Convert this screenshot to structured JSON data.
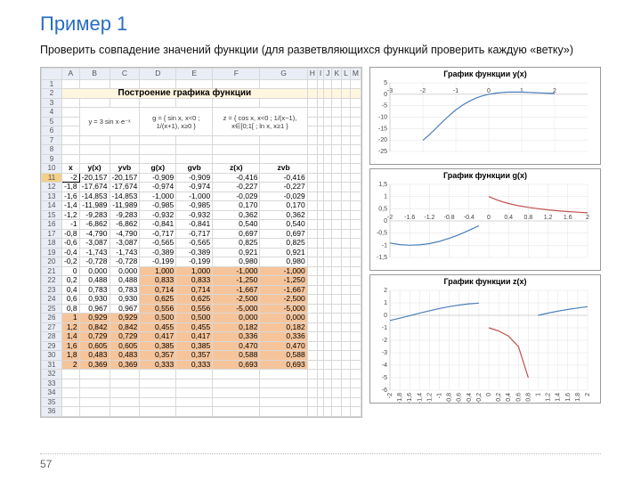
{
  "title": "Пример 1",
  "subtitle": "Проверить совпадение значений функции (для разветвляющихся функций проверить каждую «ветку»)",
  "pagenum": "57",
  "columns": [
    "",
    "A",
    "B",
    "C",
    "D",
    "E",
    "F",
    "G",
    "H",
    "I",
    "J",
    "K",
    "L",
    "M"
  ],
  "sheet_title": "Построение графика функции",
  "formula_y": "y = 3 sin x·e⁻ˣ",
  "formula_g": "g = { sin x, x<0 ; 1/(x+1), x≥0 }",
  "formula_z": "z = { cos x, x<0 ; 1/(x−1), x∈[0;1[ ; ln x, x≥1 }",
  "headers": [
    "x",
    "y(x)",
    "yvb",
    "g(x)",
    "gvb",
    "z(x)",
    "zvb"
  ],
  "rows": [
    {
      "n": 11,
      "sel": true,
      "x": "-2",
      "y": "-20,157",
      "yvb": "-20,157",
      "g": "-0,909",
      "gvb": "-0,909",
      "z": "-0,416",
      "zvb": "-0,416"
    },
    {
      "n": 12,
      "x": "-1,8",
      "y": "-17,674",
      "yvb": "-17,674",
      "g": "-0,974",
      "gvb": "-0,974",
      "z": "-0,227",
      "zvb": "-0,227"
    },
    {
      "n": 13,
      "x": "-1,6",
      "y": "-14,853",
      "yvb": "-14,853",
      "g": "-1,000",
      "gvb": "-1,000",
      "z": "-0,029",
      "zvb": "-0,029"
    },
    {
      "n": 14,
      "x": "-1,4",
      "y": "-11,989",
      "yvb": "-11,989",
      "g": "-0,985",
      "gvb": "-0,985",
      "z": "0,170",
      "zvb": "0,170"
    },
    {
      "n": 15,
      "x": "-1,2",
      "y": "-9,283",
      "yvb": "-9,283",
      "g": "-0,932",
      "gvb": "-0,932",
      "z": "0,362",
      "zvb": "0,362"
    },
    {
      "n": 16,
      "x": "-1",
      "y": "-6,862",
      "yvb": "-6,862",
      "g": "-0,841",
      "gvb": "-0,841",
      "z": "0,540",
      "zvb": "0,540"
    },
    {
      "n": 17,
      "x": "-0,8",
      "y": "-4,790",
      "yvb": "-4,790",
      "g": "-0,717",
      "gvb": "-0,717",
      "z": "0,697",
      "zvb": "0,697"
    },
    {
      "n": 18,
      "x": "-0,6",
      "y": "-3,087",
      "yvb": "-3,087",
      "g": "-0,565",
      "gvb": "-0,565",
      "z": "0,825",
      "zvb": "0,825"
    },
    {
      "n": 19,
      "x": "-0,4",
      "y": "-1,743",
      "yvb": "-1,743",
      "g": "-0,389",
      "gvb": "-0,389",
      "z": "0,921",
      "zvb": "0,921"
    },
    {
      "n": 20,
      "x": "-0,2",
      "y": "-0,728",
      "yvb": "-0,728",
      "g": "-0,199",
      "gvb": "-0,199",
      "z": "0,980",
      "zvb": "0,980"
    },
    {
      "n": 21,
      "peach": "gz",
      "x": "0",
      "y": "0,000",
      "yvb": "0,000",
      "g": "1,000",
      "gvb": "1,000",
      "z": "-1,000",
      "zvb": "-1,000"
    },
    {
      "n": 22,
      "peach": "gz",
      "x": "0,2",
      "y": "0,488",
      "yvb": "0,488",
      "g": "0,833",
      "gvb": "0,833",
      "z": "-1,250",
      "zvb": "-1,250"
    },
    {
      "n": 23,
      "peach": "gz",
      "x": "0,4",
      "y": "0,783",
      "yvb": "0,783",
      "g": "0,714",
      "gvb": "0,714",
      "z": "-1,667",
      "zvb": "-1,667"
    },
    {
      "n": 24,
      "peach": "gz",
      "x": "0,6",
      "y": "0,930",
      "yvb": "0,930",
      "g": "0,625",
      "gvb": "0,625",
      "z": "-2,500",
      "zvb": "-2,500"
    },
    {
      "n": 25,
      "peach": "gz",
      "x": "0,8",
      "y": "0,967",
      "yvb": "0,967",
      "g": "0,556",
      "gvb": "0,556",
      "z": "-5,000",
      "zvb": "-5,000"
    },
    {
      "n": 26,
      "peach": "all",
      "x": "1",
      "y": "0,929",
      "yvb": "0,929",
      "g": "0,500",
      "gvb": "0,500",
      "z": "0,000",
      "zvb": "0,000"
    },
    {
      "n": 27,
      "peach": "all",
      "x": "1,2",
      "y": "0,842",
      "yvb": "0,842",
      "g": "0,455",
      "gvb": "0,455",
      "z": "0,182",
      "zvb": "0,182"
    },
    {
      "n": 28,
      "peach": "all",
      "x": "1,4",
      "y": "0,729",
      "yvb": "0,729",
      "g": "0,417",
      "gvb": "0,417",
      "z": "0,336",
      "zvb": "0,336"
    },
    {
      "n": 29,
      "peach": "all",
      "x": "1,6",
      "y": "0,605",
      "yvb": "0,605",
      "g": "0,385",
      "gvb": "0,385",
      "z": "0,470",
      "zvb": "0,470"
    },
    {
      "n": 30,
      "peach": "all",
      "x": "1,8",
      "y": "0,483",
      "yvb": "0,483",
      "g": "0,357",
      "gvb": "0,357",
      "z": "0,588",
      "zvb": "0,588"
    },
    {
      "n": 31,
      "peach": "all",
      "x": "2",
      "y": "0,369",
      "yvb": "0,369",
      "g": "0,333",
      "gvb": "0,333",
      "z": "0,693",
      "zvb": "0,693"
    }
  ],
  "empty_rows": [
    32,
    33,
    34,
    35,
    36
  ],
  "charts": [
    {
      "title": "График функции y(x)",
      "xmin": -3,
      "xmax": 3,
      "ymin": -25,
      "ymax": 5,
      "yticks": [
        -25,
        -20,
        -15,
        -10,
        -5,
        0,
        5
      ],
      "xticks": [
        -3,
        -2,
        -1,
        0,
        1,
        2
      ],
      "series": [
        {
          "cls": "curve",
          "pts": [
            [
              -2,
              -20.157
            ],
            [
              -1.8,
              -17.674
            ],
            [
              -1.6,
              -14.853
            ],
            [
              -1.4,
              -11.989
            ],
            [
              -1.2,
              -9.283
            ],
            [
              -1,
              -6.862
            ],
            [
              -0.8,
              -4.79
            ],
            [
              -0.6,
              -3.087
            ],
            [
              -0.4,
              -1.743
            ],
            [
              -0.2,
              -0.728
            ],
            [
              0,
              0
            ],
            [
              0.2,
              0.488
            ],
            [
              0.4,
              0.783
            ],
            [
              0.6,
              0.93
            ],
            [
              0.8,
              0.967
            ],
            [
              1,
              0.929
            ],
            [
              1.2,
              0.842
            ],
            [
              1.4,
              0.729
            ],
            [
              1.6,
              0.605
            ],
            [
              1.8,
              0.483
            ],
            [
              2,
              0.369
            ]
          ]
        }
      ]
    },
    {
      "title": "График функции g(x)",
      "xmin": -2,
      "xmax": 2,
      "ymin": -1.5,
      "ymax": 1.5,
      "yticks": [
        -1.5,
        -1,
        -0.5,
        0,
        0.5,
        1,
        1.5
      ],
      "xticks": [
        -2,
        -1.6,
        -1.2,
        -0.8,
        -0.4,
        0,
        0.4,
        0.8,
        1.2,
        1.6,
        2
      ],
      "series": [
        {
          "cls": "curve",
          "pts": [
            [
              -2,
              -0.909
            ],
            [
              -1.8,
              -0.974
            ],
            [
              -1.6,
              -1
            ],
            [
              -1.4,
              -0.985
            ],
            [
              -1.2,
              -0.932
            ],
            [
              -1,
              -0.841
            ],
            [
              -0.8,
              -0.717
            ],
            [
              -0.6,
              -0.565
            ],
            [
              -0.4,
              -0.389
            ],
            [
              -0.2,
              -0.199
            ]
          ]
        },
        {
          "cls": "curve2",
          "pts": [
            [
              0,
              1
            ],
            [
              0.2,
              0.833
            ],
            [
              0.4,
              0.714
            ],
            [
              0.6,
              0.625
            ],
            [
              0.8,
              0.556
            ],
            [
              1,
              0.5
            ],
            [
              1.2,
              0.455
            ],
            [
              1.4,
              0.417
            ],
            [
              1.6,
              0.385
            ],
            [
              1.8,
              0.357
            ],
            [
              2,
              0.333
            ]
          ]
        }
      ]
    },
    {
      "title": "График функции z(x)",
      "xmin": -2,
      "xmax": 2,
      "ymin": -6,
      "ymax": 2,
      "yticks": [
        -6,
        -5,
        -4,
        -3,
        -2,
        -1,
        0,
        1,
        2
      ],
      "xticks_rot": [
        -2,
        -1.8,
        -1.6,
        -1.4,
        -1.2,
        -1,
        -0.8,
        -0.6,
        -0.4,
        -0.2,
        0,
        0.2,
        0.4,
        0.6,
        0.8,
        1,
        1.2,
        1.4,
        1.6,
        1.8,
        2
      ],
      "series": [
        {
          "cls": "curve",
          "pts": [
            [
              -2,
              -0.416
            ],
            [
              -1.8,
              -0.227
            ],
            [
              -1.6,
              -0.029
            ],
            [
              -1.4,
              0.17
            ],
            [
              -1.2,
              0.362
            ],
            [
              -1,
              0.54
            ],
            [
              -0.8,
              0.697
            ],
            [
              -0.6,
              0.825
            ],
            [
              -0.4,
              0.921
            ],
            [
              -0.2,
              0.98
            ]
          ]
        },
        {
          "cls": "curve2",
          "pts": [
            [
              0,
              -1
            ],
            [
              0.2,
              -1.25
            ],
            [
              0.4,
              -1.667
            ],
            [
              0.6,
              -2.5
            ],
            [
              0.8,
              -5
            ]
          ]
        },
        {
          "cls": "curve",
          "pts": [
            [
              1,
              0
            ],
            [
              1.2,
              0.182
            ],
            [
              1.4,
              0.336
            ],
            [
              1.6,
              0.47
            ],
            [
              1.8,
              0.588
            ],
            [
              2,
              0.693
            ]
          ]
        }
      ]
    }
  ],
  "chart_data": [
    {
      "type": "line",
      "title": "График функции y(x)",
      "xlabel": "",
      "ylabel": "",
      "xlim": [
        -3,
        3
      ],
      "ylim": [
        -25,
        5
      ],
      "x": [
        -2,
        -1.8,
        -1.6,
        -1.4,
        -1.2,
        -1,
        -0.8,
        -0.6,
        -0.4,
        -0.2,
        0,
        0.2,
        0.4,
        0.6,
        0.8,
        1,
        1.2,
        1.4,
        1.6,
        1.8,
        2
      ],
      "series": [
        {
          "name": "y(x)",
          "values": [
            -20.157,
            -17.674,
            -14.853,
            -11.989,
            -9.283,
            -6.862,
            -4.79,
            -3.087,
            -1.743,
            -0.728,
            0,
            0.488,
            0.783,
            0.93,
            0.967,
            0.929,
            0.842,
            0.729,
            0.605,
            0.483,
            0.369
          ]
        }
      ]
    },
    {
      "type": "line",
      "title": "График функции g(x)",
      "xlabel": "",
      "ylabel": "",
      "xlim": [
        -2,
        2
      ],
      "ylim": [
        -1.5,
        1.5
      ],
      "x": [
        -2,
        -1.8,
        -1.6,
        -1.4,
        -1.2,
        -1,
        -0.8,
        -0.6,
        -0.4,
        -0.2,
        0,
        0.2,
        0.4,
        0.6,
        0.8,
        1,
        1.2,
        1.4,
        1.6,
        1.8,
        2
      ],
      "series": [
        {
          "name": "g(x)",
          "values": [
            -0.909,
            -0.974,
            -1,
            -0.985,
            -0.932,
            -0.841,
            -0.717,
            -0.565,
            -0.389,
            -0.199,
            1,
            0.833,
            0.714,
            0.625,
            0.556,
            0.5,
            0.455,
            0.417,
            0.385,
            0.357,
            0.333
          ]
        }
      ]
    },
    {
      "type": "line",
      "title": "График функции z(x)",
      "xlabel": "",
      "ylabel": "",
      "xlim": [
        -2,
        2
      ],
      "ylim": [
        -6,
        2
      ],
      "x": [
        -2,
        -1.8,
        -1.6,
        -1.4,
        -1.2,
        -1,
        -0.8,
        -0.6,
        -0.4,
        -0.2,
        0,
        0.2,
        0.4,
        0.6,
        0.8,
        1,
        1.2,
        1.4,
        1.6,
        1.8,
        2
      ],
      "series": [
        {
          "name": "z(x)",
          "values": [
            -0.416,
            -0.227,
            -0.029,
            0.17,
            0.362,
            0.54,
            0.697,
            0.825,
            0.921,
            0.98,
            -1,
            -1.25,
            -1.667,
            -2.5,
            -5,
            0,
            0.182,
            0.336,
            0.47,
            0.588,
            0.693
          ]
        }
      ]
    }
  ]
}
